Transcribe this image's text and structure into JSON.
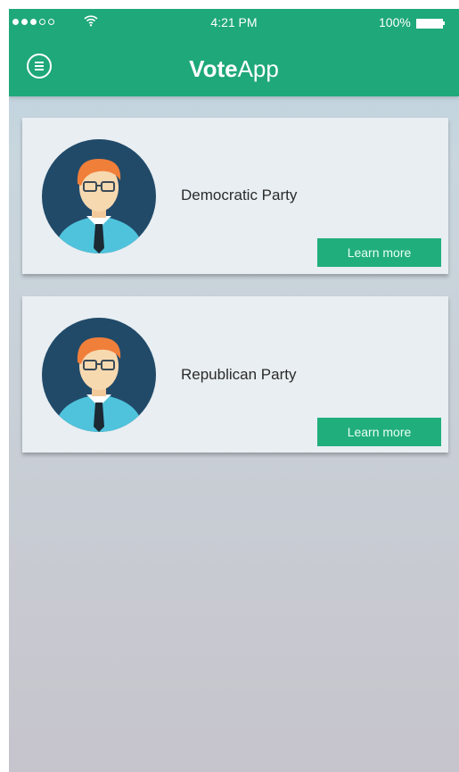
{
  "status_bar": {
    "time": "4:21 PM",
    "battery": "100%",
    "signal_icon": "signal-dots-icon",
    "wifi_icon": "wifi-icon"
  },
  "header": {
    "title_bold": "Vote",
    "title_regular": "App",
    "menu_icon": "menu-icon",
    "color": "#1fa87a"
  },
  "parties": [
    {
      "name": "Democratic Party",
      "button": "Learn more",
      "avatar_icon": "candidate-avatar-icon"
    },
    {
      "name": "Republican Party",
      "button": "Learn more",
      "avatar_icon": "candidate-avatar-icon"
    }
  ],
  "colors": {
    "accent": "#21ae7d",
    "avatar_bg": "#214a69"
  }
}
